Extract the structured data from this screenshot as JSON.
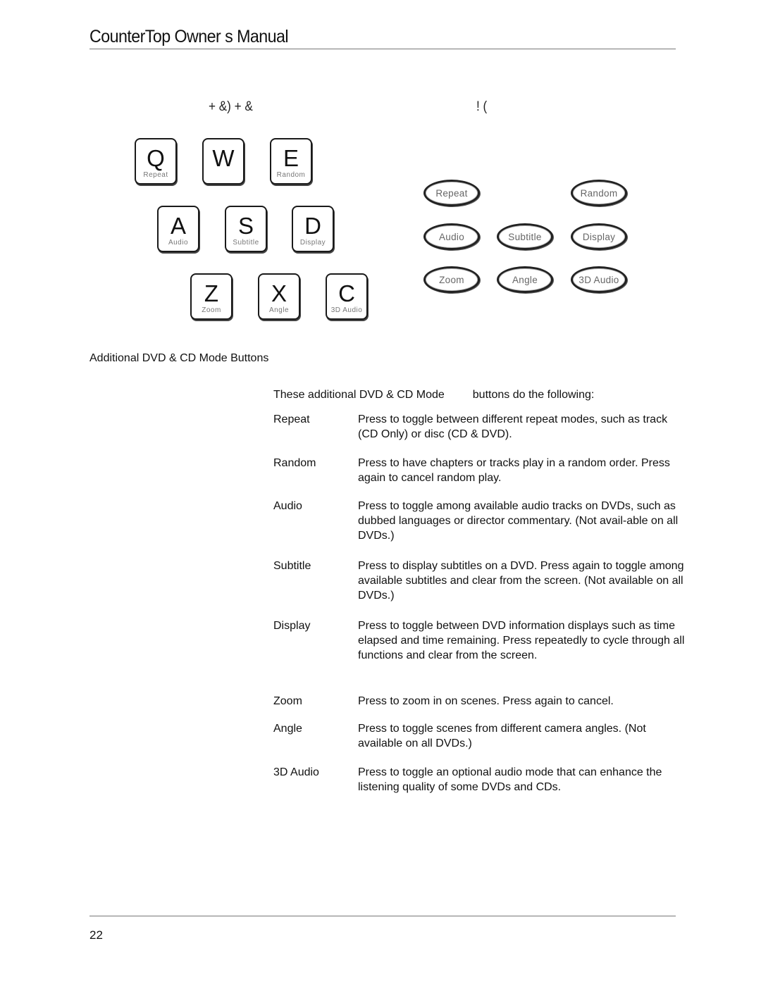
{
  "header": {
    "title": "CounterTop Owner s Manual"
  },
  "figure_captions": {
    "left": "+ &)   + &",
    "right": "!   ("
  },
  "keyboard_keys": [
    {
      "letter": "Q",
      "label": "Repeat"
    },
    {
      "letter": "W",
      "label": ""
    },
    {
      "letter": "E",
      "label": "Random"
    },
    {
      "letter": "A",
      "label": "Audio"
    },
    {
      "letter": "S",
      "label": "Subtitle"
    },
    {
      "letter": "D",
      "label": "Display"
    },
    {
      "letter": "Z",
      "label": "Zoom"
    },
    {
      "letter": "X",
      "label": "Angle"
    },
    {
      "letter": "C",
      "label": "3D Audio"
    }
  ],
  "remote_buttons": [
    {
      "label": "Repeat"
    },
    {
      "label": "Random"
    },
    {
      "label": "Audio"
    },
    {
      "label": "Subtitle"
    },
    {
      "label": "Display"
    },
    {
      "label": "Zoom"
    },
    {
      "label": "Angle"
    },
    {
      "label": "3D Audio"
    }
  ],
  "section": {
    "heading": "Additional DVD & CD Mode Buttons",
    "intro_part1": "These additional DVD & CD Mode",
    "intro_part2": "buttons do the following:"
  },
  "definitions": [
    {
      "term": "Repeat",
      "description": "Press to toggle between different repeat modes, such as track (CD Only) or disc (CD & DVD)."
    },
    {
      "term": "Random",
      "description": "Press to have chapters or tracks play in a random order. Press again to cancel random play."
    },
    {
      "term": "Audio",
      "description": "Press to toggle among available audio tracks on DVDs, such as dubbed languages or director commentary. (Not avail-able on all DVDs.)"
    },
    {
      "term": "Subtitle",
      "description": "Press to display subtitles on a DVD. Press again to toggle among available subtitles and clear from the screen. (Not available on all DVDs.)"
    },
    {
      "term": "Display",
      "description": "Press to toggle between DVD information displays such as time elapsed and time remaining. Press repeatedly to cycle through all functions and clear from the screen."
    },
    {
      "term": "Zoom",
      "description": "Press to zoom in on scenes. Press again to cancel."
    },
    {
      "term": "Angle",
      "description": "Press to toggle scenes from different camera angles. (Not available on all DVDs.)"
    },
    {
      "term": "3D Audio",
      "description": "Press to toggle an optional audio mode that can enhance the listening quality of some DVDs and CDs."
    }
  ],
  "footer": {
    "page_number": "22"
  }
}
